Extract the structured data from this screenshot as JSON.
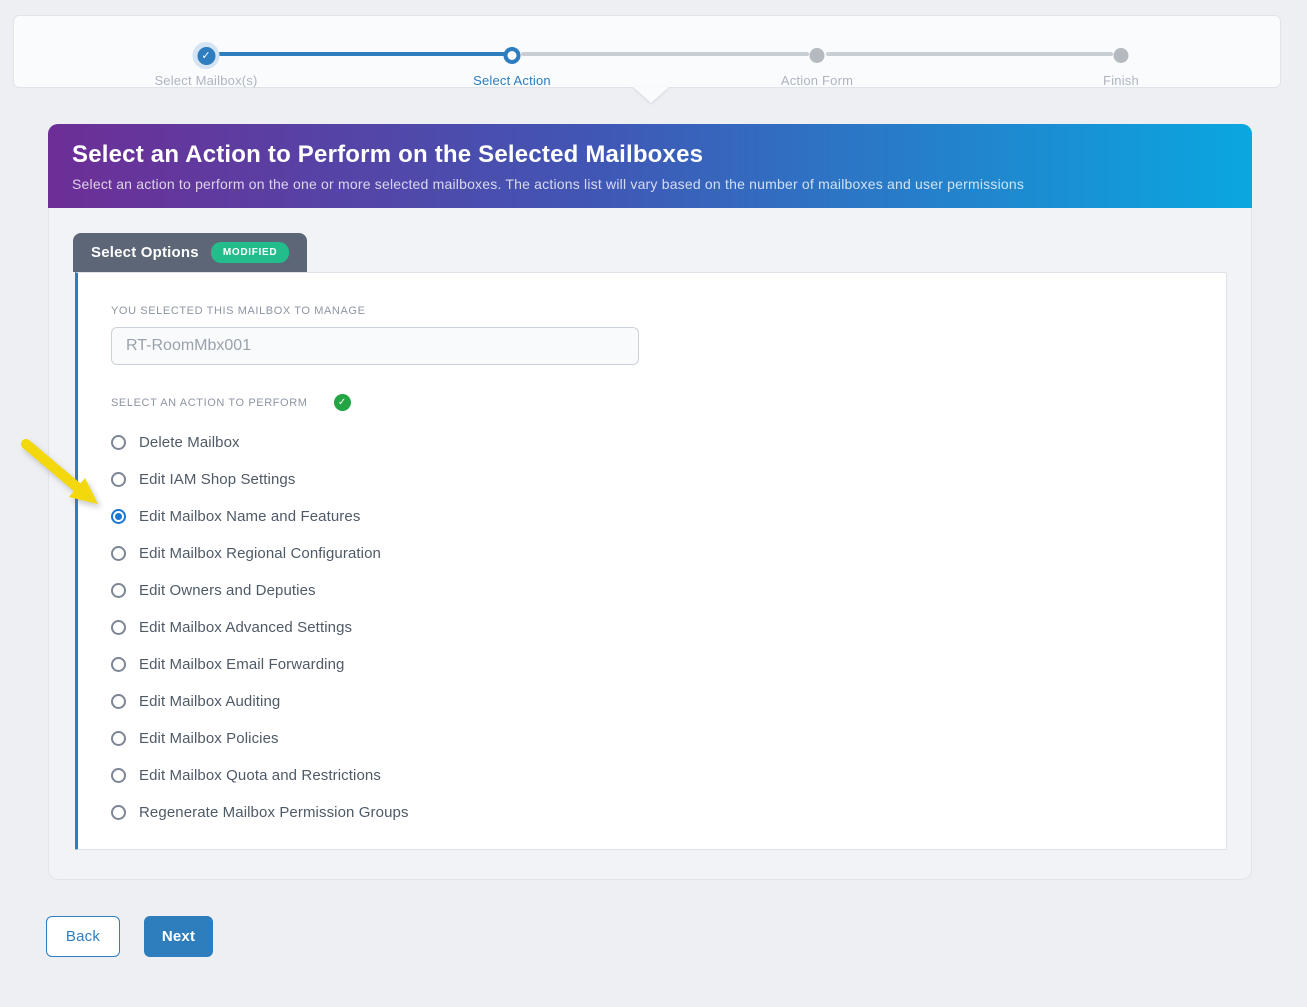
{
  "stepper": {
    "steps": [
      {
        "label": "Select Mailbox(s)",
        "state": "done"
      },
      {
        "label": "Select Action",
        "state": "active"
      },
      {
        "label": "Action Form",
        "state": "pending"
      },
      {
        "label": "Finish",
        "state": "pending"
      }
    ]
  },
  "banner": {
    "title": "Select an Action to Perform on the Selected Mailboxes",
    "subtitle": "Select an action to perform on the one or more selected mailboxes. The actions list will vary based on the number of mailboxes and user permissions"
  },
  "tab": {
    "label": "Select Options",
    "badge": "MODIFIED"
  },
  "form": {
    "mailbox_label": "YOU SELECTED THIS MAILBOX TO MANAGE",
    "mailbox_value": "RT-RoomMbx001",
    "action_label": "SELECT AN ACTION TO PERFORM",
    "options": [
      {
        "label": "Delete Mailbox",
        "selected": false
      },
      {
        "label": "Edit IAM Shop Settings",
        "selected": false
      },
      {
        "label": "Edit Mailbox Name and Features",
        "selected": true
      },
      {
        "label": "Edit Mailbox Regional Configuration",
        "selected": false
      },
      {
        "label": "Edit Owners and Deputies",
        "selected": false
      },
      {
        "label": "Edit Mailbox Advanced Settings",
        "selected": false
      },
      {
        "label": "Edit Mailbox Email Forwarding",
        "selected": false
      },
      {
        "label": "Edit Mailbox Auditing",
        "selected": false
      },
      {
        "label": "Edit Mailbox Policies",
        "selected": false
      },
      {
        "label": "Edit Mailbox Quota and Restrictions",
        "selected": false
      },
      {
        "label": "Regenerate Mailbox Permission Groups",
        "selected": false
      }
    ]
  },
  "buttons": {
    "back": "Back",
    "next": "Next"
  },
  "colors": {
    "accent_blue": "#2d7dbf",
    "radio_blue": "#1976d2",
    "badge_green": "#22bd8b",
    "check_green": "#23a445",
    "banner_purple": "#6d2e96",
    "banner_cyan": "#0aa7e0",
    "tab_slate": "#5c6676",
    "arrow_yellow": "#f2d80c"
  }
}
